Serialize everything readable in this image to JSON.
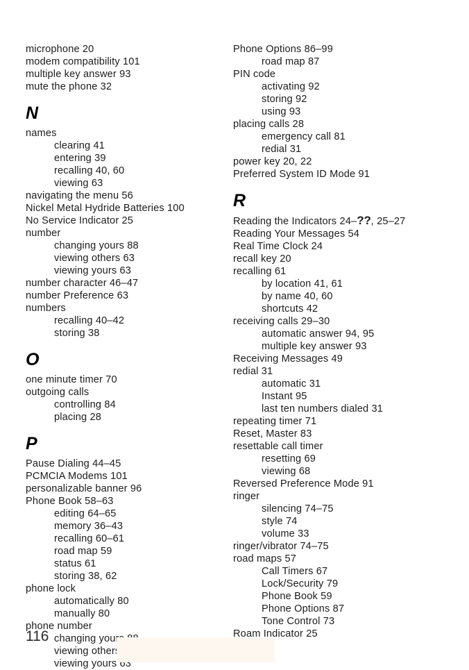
{
  "page": {
    "folio": "116",
    "bleed_block_color": "#fdf7f0",
    "text_color": "#1c1c1c",
    "background_color": "#ffffff"
  },
  "columns": [
    {
      "id": "left",
      "blocks": [
        {
          "type": "entries",
          "entries": [
            {
              "level": 0,
              "text": "microphone 20"
            },
            {
              "level": 0,
              "text": "modem compatibility 101"
            },
            {
              "level": 0,
              "text": "multiple key answer 93"
            },
            {
              "level": 0,
              "text": "mute the phone 32"
            }
          ]
        },
        {
          "type": "letter",
          "letter": "N",
          "entries": [
            {
              "level": 0,
              "text": "names"
            },
            {
              "level": 1,
              "text": "clearing 41"
            },
            {
              "level": 1,
              "text": "entering 39"
            },
            {
              "level": 1,
              "text": "recalling 40, 60"
            },
            {
              "level": 1,
              "text": "viewing 63"
            },
            {
              "level": 0,
              "text": "navigating the menu 56"
            },
            {
              "level": 0,
              "text": "Nickel Metal Hydride Batteries 100"
            },
            {
              "level": 0,
              "text": "No Service Indicator 25"
            },
            {
              "level": 0,
              "text": "number"
            },
            {
              "level": 1,
              "text": "changing yours 88"
            },
            {
              "level": 1,
              "text": "viewing others 63"
            },
            {
              "level": 1,
              "text": "viewing yours 63"
            },
            {
              "level": 0,
              "text": "number character 46–47"
            },
            {
              "level": 0,
              "text": "number Preference 63"
            },
            {
              "level": 0,
              "text": "numbers"
            },
            {
              "level": 1,
              "text": "recalling 40–42"
            },
            {
              "level": 1,
              "text": "storing 38"
            }
          ]
        },
        {
          "type": "letter",
          "letter": "O",
          "entries": [
            {
              "level": 0,
              "text": "one minute timer 70"
            },
            {
              "level": 0,
              "text": "outgoing calls"
            },
            {
              "level": 1,
              "text": "controlling 84"
            },
            {
              "level": 1,
              "text": "placing 28"
            }
          ]
        },
        {
          "type": "letter",
          "letter": "P",
          "entries": [
            {
              "level": 0,
              "text": "Pause Dialing 44–45"
            },
            {
              "level": 0,
              "text": "PCMCIA Modems 101"
            },
            {
              "level": 0,
              "text": "personalizable banner 96"
            },
            {
              "level": 0,
              "text": "Phone Book 58–63"
            },
            {
              "level": 1,
              "text": "editing 64–65"
            },
            {
              "level": 1,
              "text": "memory 36–43"
            },
            {
              "level": 1,
              "text": "recalling 60–61"
            },
            {
              "level": 1,
              "text": "road map 59"
            },
            {
              "level": 1,
              "text": "status 61"
            },
            {
              "level": 1,
              "text": "storing 38, 62"
            },
            {
              "level": 0,
              "text": "phone lock"
            },
            {
              "level": 1,
              "text": "automatically 80"
            },
            {
              "level": 1,
              "text": "manually 80"
            },
            {
              "level": 0,
              "text": "phone number"
            },
            {
              "level": 1,
              "text": "changing yours 88"
            },
            {
              "level": 1,
              "text": "viewing others 63"
            },
            {
              "level": 1,
              "text": "viewing yours 63"
            }
          ]
        }
      ]
    },
    {
      "id": "right",
      "blocks": [
        {
          "type": "entries",
          "entries": [
            {
              "level": 0,
              "text": "Phone Options 86–99"
            },
            {
              "level": 1,
              "text": "road map 87"
            },
            {
              "level": 0,
              "text": "PIN code"
            },
            {
              "level": 1,
              "text": "activating 92"
            },
            {
              "level": 1,
              "text": "storing 92"
            },
            {
              "level": 1,
              "text": "using 93"
            },
            {
              "level": 0,
              "text": "placing calls 28"
            },
            {
              "level": 1,
              "text": "emergency call 81"
            },
            {
              "level": 1,
              "text": "redial 31"
            },
            {
              "level": 0,
              "text": "power key 20, 22"
            },
            {
              "level": 0,
              "text": "Preferred System ID Mode 91"
            }
          ]
        },
        {
          "type": "letter",
          "letter": "R",
          "entries": [
            {
              "level": 0,
              "rich": true,
              "parts": [
                {
                  "text": "Reading the Indicators 24–"
                },
                {
                  "text": "??",
                  "style": "xref-unresolved"
                },
                {
                  "text": ", 25–27"
                }
              ],
              "text": "Reading the Indicators 24–??, 25–27"
            },
            {
              "level": 0,
              "text": "Reading Your Messages 54"
            },
            {
              "level": 0,
              "text": "Real Time Clock 24"
            },
            {
              "level": 0,
              "text": "recall key 20"
            },
            {
              "level": 0,
              "text": "recalling 61"
            },
            {
              "level": 1,
              "text": "by location 41, 61"
            },
            {
              "level": 1,
              "text": "by name 40, 60"
            },
            {
              "level": 1,
              "text": "shortcuts 42"
            },
            {
              "level": 0,
              "text": "receiving calls 29–30"
            },
            {
              "level": 1,
              "text": "automatic answer 94, 95"
            },
            {
              "level": 1,
              "text": "multiple key answer 93"
            },
            {
              "level": 0,
              "text": "Receiving Messages 49"
            },
            {
              "level": 0,
              "text": "redial 31"
            },
            {
              "level": 1,
              "text": "automatic 31"
            },
            {
              "level": 1,
              "text": "Instant 95"
            },
            {
              "level": 1,
              "text": "last ten numbers dialed 31"
            },
            {
              "level": 0,
              "text": "repeating timer 71"
            },
            {
              "level": 0,
              "text": "Reset, Master 83"
            },
            {
              "level": 0,
              "text": "resettable call timer"
            },
            {
              "level": 1,
              "text": "resetting 69"
            },
            {
              "level": 1,
              "text": "viewing 68"
            },
            {
              "level": 0,
              "text": "Reversed Preference Mode 91"
            },
            {
              "level": 0,
              "text": "ringer"
            },
            {
              "level": 1,
              "text": "silencing 74–75"
            },
            {
              "level": 1,
              "text": "style 74"
            },
            {
              "level": 1,
              "text": "volume 33"
            },
            {
              "level": 0,
              "text": "ringer/vibrator 74–75"
            },
            {
              "level": 0,
              "text": "road maps 57"
            },
            {
              "level": 1,
              "text": "Call Timers 67"
            },
            {
              "level": 1,
              "text": "Lock/Security 79"
            },
            {
              "level": 1,
              "text": "Phone Book 59"
            },
            {
              "level": 1,
              "text": "Phone Options 87"
            },
            {
              "level": 1,
              "text": "Tone Control 73"
            },
            {
              "level": 0,
              "text": "Roam Indicator 25"
            }
          ]
        }
      ]
    }
  ]
}
